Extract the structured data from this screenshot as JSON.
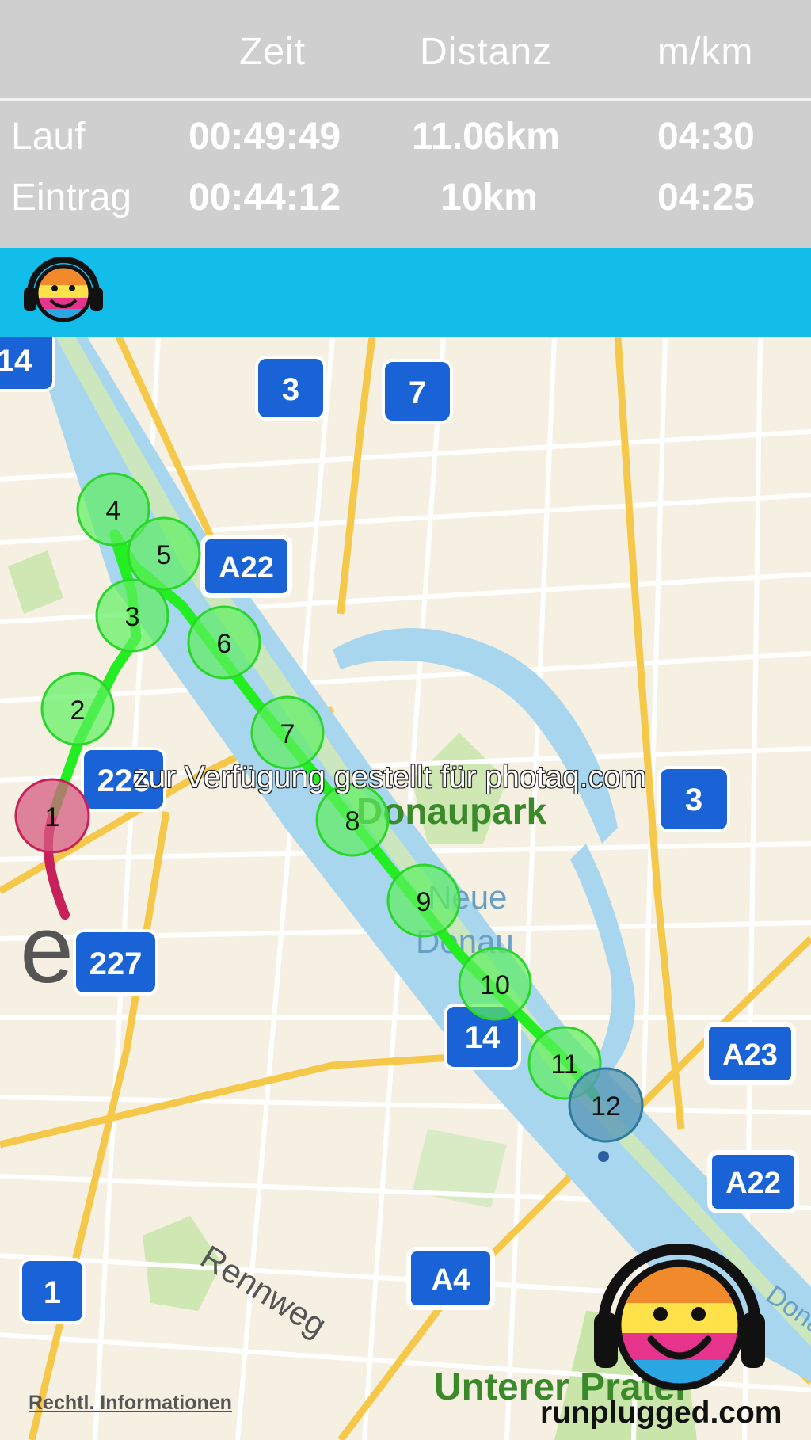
{
  "stats": {
    "headers": {
      "time": "Zeit",
      "distance": "Distanz",
      "pace": "m/km"
    },
    "rows": [
      {
        "label": "Lauf",
        "time": "00:49:49",
        "distance": "11.06km",
        "pace": "04:30"
      },
      {
        "label": "Eintrag",
        "time": "00:44:12",
        "distance": "10km",
        "pace": "04:25"
      }
    ]
  },
  "map": {
    "city_label": "Wien",
    "city_label_visible": "ien",
    "places": {
      "donaupark": "Donaupark",
      "neue_donau_1": "Neue",
      "neue_donau_2": "Donau",
      "unterer_prater": "Unterer Prater",
      "rennweg": "Rennweg",
      "donau_edge": "Donau"
    },
    "road_shields": [
      {
        "id": "s14a",
        "text": "14"
      },
      {
        "id": "s3a",
        "text": "3"
      },
      {
        "id": "s7",
        "text": "7"
      },
      {
        "id": "a22a",
        "text": "A22"
      },
      {
        "id": "s226",
        "text": "226"
      },
      {
        "id": "s3b",
        "text": "3"
      },
      {
        "id": "s227",
        "text": "227"
      },
      {
        "id": "s14b",
        "text": "14"
      },
      {
        "id": "a23",
        "text": "A23"
      },
      {
        "id": "a22b",
        "text": "A22"
      },
      {
        "id": "a4",
        "text": "A4"
      },
      {
        "id": "s1",
        "text": "1"
      }
    ],
    "km_markers": [
      {
        "label": "1",
        "status": "start"
      },
      {
        "label": "2",
        "status": "km"
      },
      {
        "label": "3",
        "status": "km"
      },
      {
        "label": "4",
        "status": "km"
      },
      {
        "label": "5",
        "status": "km"
      },
      {
        "label": "6",
        "status": "km"
      },
      {
        "label": "7",
        "status": "km"
      },
      {
        "label": "8",
        "status": "km"
      },
      {
        "label": "9",
        "status": "km"
      },
      {
        "label": "10",
        "status": "km"
      },
      {
        "label": "11",
        "status": "km"
      },
      {
        "label": "12",
        "status": "end"
      }
    ]
  },
  "watermark": "zur Verfügung gestellt für photaq.com",
  "legal_link": "Rechtl. Informationen",
  "brand": "runplugged.com",
  "colors": {
    "track_green": "#22ee22",
    "track_red": "#c8205a",
    "topbar": "#13bde9",
    "stats_bg": "#cfcfcf",
    "shield_blue": "#1a63d6"
  }
}
